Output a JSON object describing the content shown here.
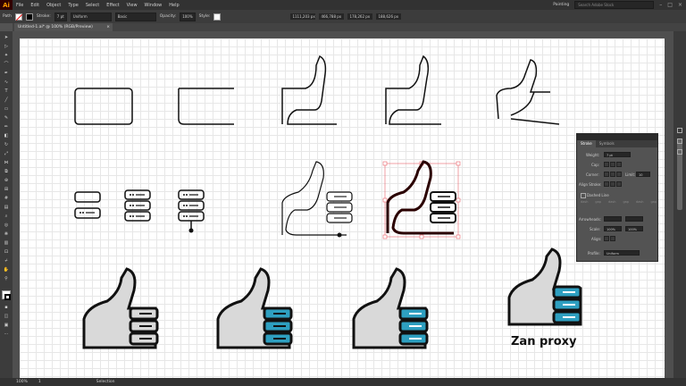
{
  "app": {
    "logo": "Ai",
    "workspace": "Painting",
    "search_placeholder": "Search Adobe Stock"
  },
  "menu": {
    "items": [
      "File",
      "Edit",
      "Object",
      "Type",
      "Select",
      "Effect",
      "View",
      "Window",
      "Help"
    ]
  },
  "control_bar": {
    "selection_label": "Path",
    "stroke_label": "Stroke:",
    "stroke_weight": "7 pt",
    "profile_value": "Uniform",
    "brush_value": "Basic",
    "opacity_label": "Opacity:",
    "opacity_value": "100%",
    "style_label": "Style:",
    "x_value": "1111,203 px",
    "y_value": "466,788 px",
    "w_value": "178,262 px",
    "h_value": "188,626 px"
  },
  "document": {
    "tab_title": "Untitled-1.ai* @ 100% (RGB/Preview)",
    "close_icon": "×"
  },
  "stroke_panel": {
    "tabs": [
      "Stroke",
      "Symbols"
    ],
    "weight_label": "Weight:",
    "weight_value": "7 pt",
    "cap_label": "Cap:",
    "corner_label": "Corner:",
    "limit_label": "Limit:",
    "limit_value": "10",
    "align_label": "Align Stroke:",
    "dashed_label": "Dashed Line",
    "arrowheads_label": "Arrowheads:",
    "scale_label": "Scale:",
    "scale_values": [
      "100%",
      "100%"
    ],
    "align_arrows_label": "Align:",
    "profile_label": "Profile:",
    "profile_value": "Uniform",
    "dash_labels": [
      "dash",
      "gap",
      "dash",
      "gap",
      "dash",
      "gap"
    ]
  },
  "artwork": {
    "logo_text": "Zan proxy"
  },
  "status": {
    "zoom": "100%",
    "page": "1",
    "tool": "Selection"
  },
  "colors": {
    "accent_blue": "#2e9fc0",
    "hand_gray": "#d9d9d9",
    "selection_red": "#e8616a",
    "app_bg": "#535353"
  }
}
